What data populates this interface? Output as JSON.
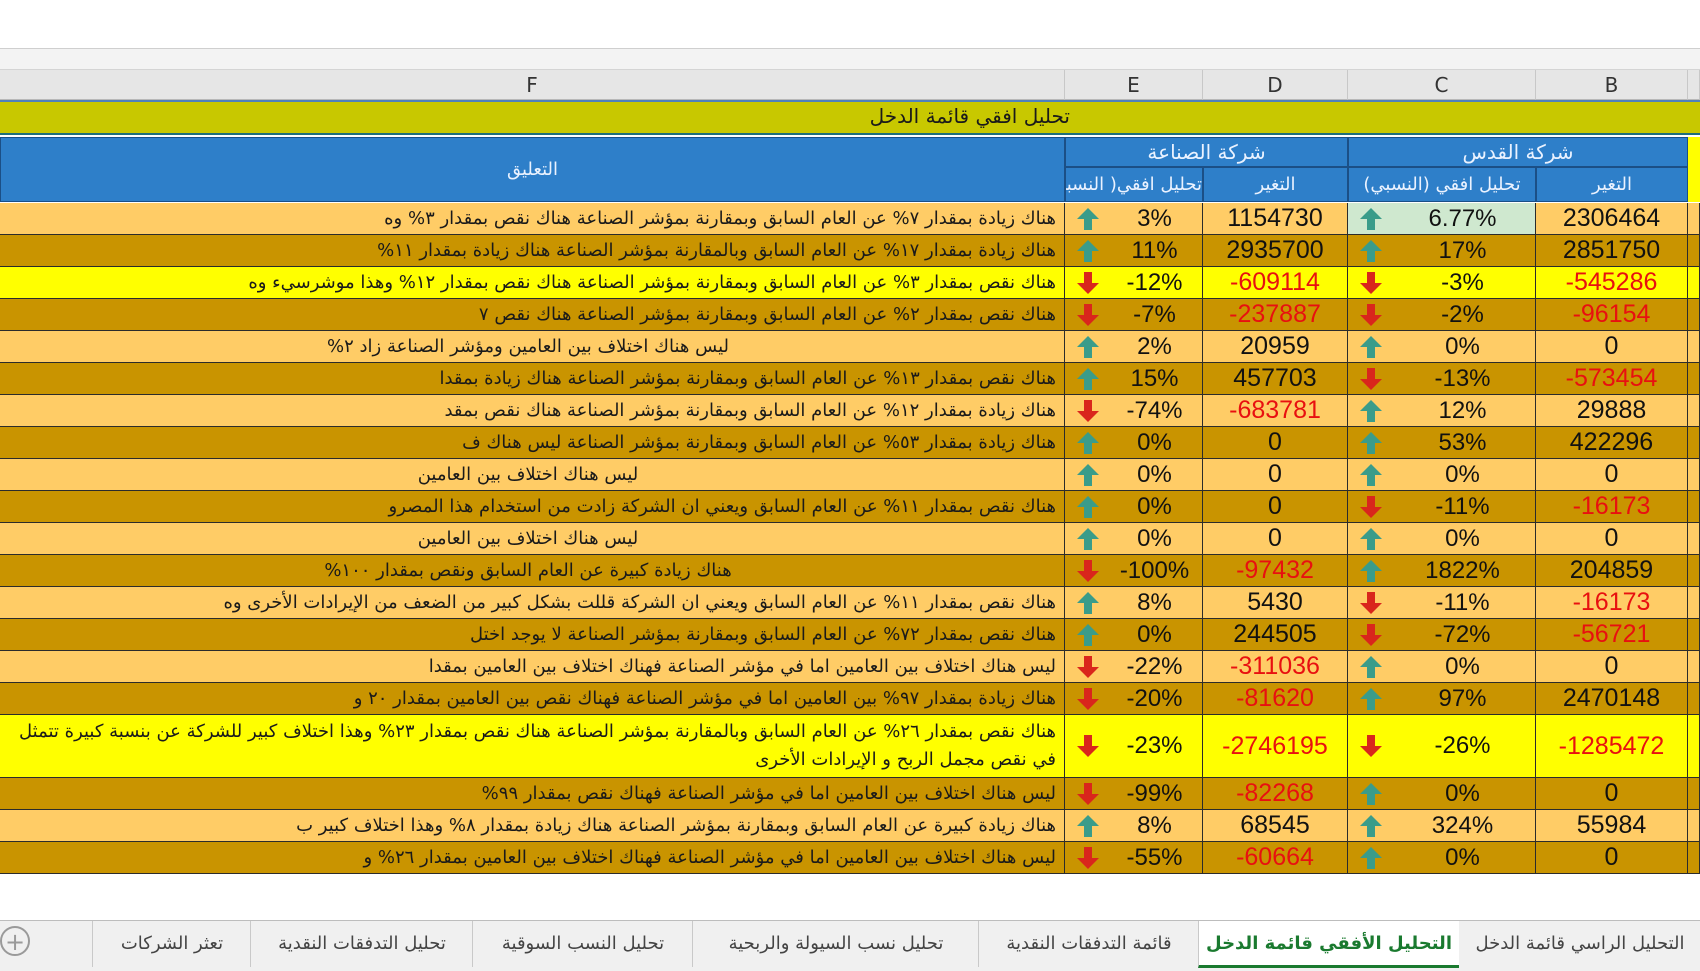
{
  "columns": [
    "F",
    "E",
    "D",
    "C",
    "B"
  ],
  "banner_title": "تحليل افقي   قائمة  الدخل",
  "headers": {
    "comment": "التعليق",
    "company_sinaa": "شركة الصناعة",
    "company_quds": "شركة القدس",
    "change": "التغير",
    "horizontal_pct": "تحليل افقي (النسبي)",
    "horizontal_pct_e": "تحليل افقي( النسبي"
  },
  "rows": [
    {
      "bg": "#ffcc66",
      "e": "3%",
      "e_dir": "up",
      "d": "1154730",
      "c": "6.77%",
      "c_dir": "up",
      "c_bg": "#cfe8cf",
      "b": "2306464",
      "comment": "هناك زيادة بمقدار ٧% عن العام السابق وبمقارنة بمؤشر الصناعة هناك نقص بمقدار ٣% وه"
    },
    {
      "bg": "#c99400",
      "e": "11%",
      "e_dir": "up",
      "d": "2935700",
      "c": "17%",
      "c_dir": "up",
      "b": "2851750",
      "comment": "هناك زيادة بمقدار ١٧% عن العام السابق وبالمقارنة بمؤشر الصناعة هناك زيادة بمقدار ١١%"
    },
    {
      "bg": "#ffff00",
      "e": "-12%",
      "e_dir": "down",
      "d": "-609114",
      "c": "-3%",
      "c_dir": "down",
      "b": "-545286",
      "comment": "هناك نقص بمقدار ٣% عن العام السابق وبمقارنة بمؤشر الصناعة هناك نقص بمقدار ١٢% وهذا موشرسيء وه"
    },
    {
      "bg": "#c99400",
      "e": "-7%",
      "e_dir": "down",
      "d": "-237887",
      "c": "-2%",
      "c_dir": "down",
      "b": "-96154",
      "comment": "هناك نقص بمقدار ٢% عن العام السابق وبمقارنة بمؤشر الصناعة هناك نقص ٧"
    },
    {
      "bg": "#ffcc66",
      "e": "2%",
      "e_dir": "up",
      "d": "20959",
      "c": "0%",
      "c_dir": "up",
      "b": "0",
      "comment": "ليس هناك اختلاف بين العامين ومؤشر الصناعة زاد ٢%",
      "center": true
    },
    {
      "bg": "#c99400",
      "e": "15%",
      "e_dir": "up",
      "d": "457703",
      "c": "-13%",
      "c_dir": "down",
      "b": "-573454",
      "comment": "هناك نقص بمقدار ١٣% عن العام السابق وبمقارنة بمؤشر الصناعة هناك زيادة بمقدا"
    },
    {
      "bg": "#ffcc66",
      "e": "-74%",
      "e_dir": "down",
      "d": "-683781",
      "c": "12%",
      "c_dir": "up",
      "b": "29888",
      "comment": "هناك زيادة بمقدار ١٢% عن العام السابق وبمقارنة بمؤشر الصناعة هناك نقص بمقد"
    },
    {
      "bg": "#c99400",
      "e": "0%",
      "e_dir": "up",
      "d": "0",
      "c": "53%",
      "c_dir": "up",
      "b": "422296",
      "comment": "هناك زيادة بمقدار ٥٣% عن العام السابق وبمقارنة بمؤشر الصناعة ليس هناك ف"
    },
    {
      "bg": "#ffcc66",
      "e": "0%",
      "e_dir": "up",
      "d": "0",
      "c": "0%",
      "c_dir": "up",
      "b": "0",
      "comment": "ليس هناك اختلاف بين العامين",
      "center": true
    },
    {
      "bg": "#c99400",
      "e": "0%",
      "e_dir": "up",
      "d": "0",
      "c": "-11%",
      "c_dir": "down",
      "b": "-16173",
      "comment": "هناك نقص بمقدار ١١% عن العام السابق ويعني ان الشركة زادت من استخدام هذا المصرو"
    },
    {
      "bg": "#ffcc66",
      "e": "0%",
      "e_dir": "up",
      "d": "0",
      "c": "0%",
      "c_dir": "up",
      "b": "0",
      "comment": "ليس هناك اختلاف بين العامين",
      "center": true
    },
    {
      "bg": "#c99400",
      "e": "-100%",
      "e_dir": "down",
      "d": "-97432",
      "c": "1822%",
      "c_dir": "up",
      "b": "204859",
      "comment": "هناك زيادة كبيرة عن العام السابق ونقص بمقدار ١٠٠%",
      "center": true
    },
    {
      "bg": "#ffcc66",
      "e": "8%",
      "e_dir": "up",
      "d": "5430",
      "c": "-11%",
      "c_dir": "down",
      "b": "-16173",
      "comment": "هناك نقص بمقدار ١١% عن العام السابق ويعني ان الشركة قللت بشكل كبير من الضعف من الإيرادات الأخرى وه"
    },
    {
      "bg": "#c99400",
      "e": "0%",
      "e_dir": "up",
      "d": "244505",
      "c": "-72%",
      "c_dir": "down",
      "b": "-56721",
      "comment": "هناك نقص  بمقدار ٧٢% عن العام السابق وبمقارنة بمؤشر الصناعة لا يوجد اختل"
    },
    {
      "bg": "#ffcc66",
      "e": "-22%",
      "e_dir": "down",
      "d": "-311036",
      "c": "0%",
      "c_dir": "up",
      "b": "0",
      "comment": "ليس هناك اختلاف بين العامين اما في مؤشر الصناعة فهناك اختلاف بين العامين بمقدا"
    },
    {
      "bg": "#c99400",
      "e": "-20%",
      "e_dir": "down",
      "d": "-81620",
      "c": "97%",
      "c_dir": "up",
      "b": "2470148",
      "comment": "هناك زيادة بمقدار ٩٧% بين العامين اما في مؤشر الصناعة فهناك نقص بين العامين بمقدار ٢٠ و"
    },
    {
      "bg": "#ffff00",
      "e": "-23%",
      "e_dir": "down",
      "d": "-2746195",
      "c": "-26%",
      "c_dir": "down",
      "b": "-1285472",
      "comment": "هناك نقص بمقدار ٢٦% عن العام السابق وبالمقارنة بمؤشر الصناعة هناك نقص بمقدار ٢٣% وهذا اختلاف كبير للشركة عن بنسبة كبيرة تتمثل في نقص مجمل الربح و الإيرادات الأخرى",
      "tall": true
    },
    {
      "bg": "#c99400",
      "e": "-99%",
      "e_dir": "down",
      "d": "-82268",
      "c": "0%",
      "c_dir": "up",
      "b": "0",
      "comment": "ليس هناك اختلاف بين العامين اما في مؤشر الصناعة فهناك نقص بمقدار ٩٩%"
    },
    {
      "bg": "#ffcc66",
      "e": "8%",
      "e_dir": "up",
      "d": "68545",
      "c": "324%",
      "c_dir": "up",
      "b": "55984",
      "comment": "هناك زيادة كبيرة  عن العام السابق وبمقارنة بمؤشر الصناعة هناك زيادة بمقدار ٨% وهذا اختلاف كبير ب"
    },
    {
      "bg": "#c99400",
      "e": "-55%",
      "e_dir": "down",
      "d": "-60664",
      "c": "0%",
      "c_dir": "up",
      "b": "0",
      "comment": "ليس هناك اختلاف بين العامين اما في مؤشر الصناعة فهناك اختلاف بين العامين بمقدار ٢٦% و"
    }
  ],
  "tabs": [
    {
      "label": "التحليل الراسي قائمة الدخل",
      "active": false
    },
    {
      "label": "التحليل الأفقي قائمة الدخل",
      "active": true
    },
    {
      "label": "قائمة التدفقات النقدية",
      "active": false
    },
    {
      "label": "تحليل نسب السيولة والربحية",
      "active": false
    },
    {
      "label": "تحليل النسب السوقية",
      "active": false
    },
    {
      "label": "تحليل التدفقات النقدية",
      "active": false
    },
    {
      "label": "تعثر الشركات",
      "active": false
    }
  ],
  "colors": {
    "up_arrow": "#3a9c8a",
    "down_arrow": "#d9261c",
    "header_blue": "#2e7fc9",
    "banner": "#c8c800"
  }
}
